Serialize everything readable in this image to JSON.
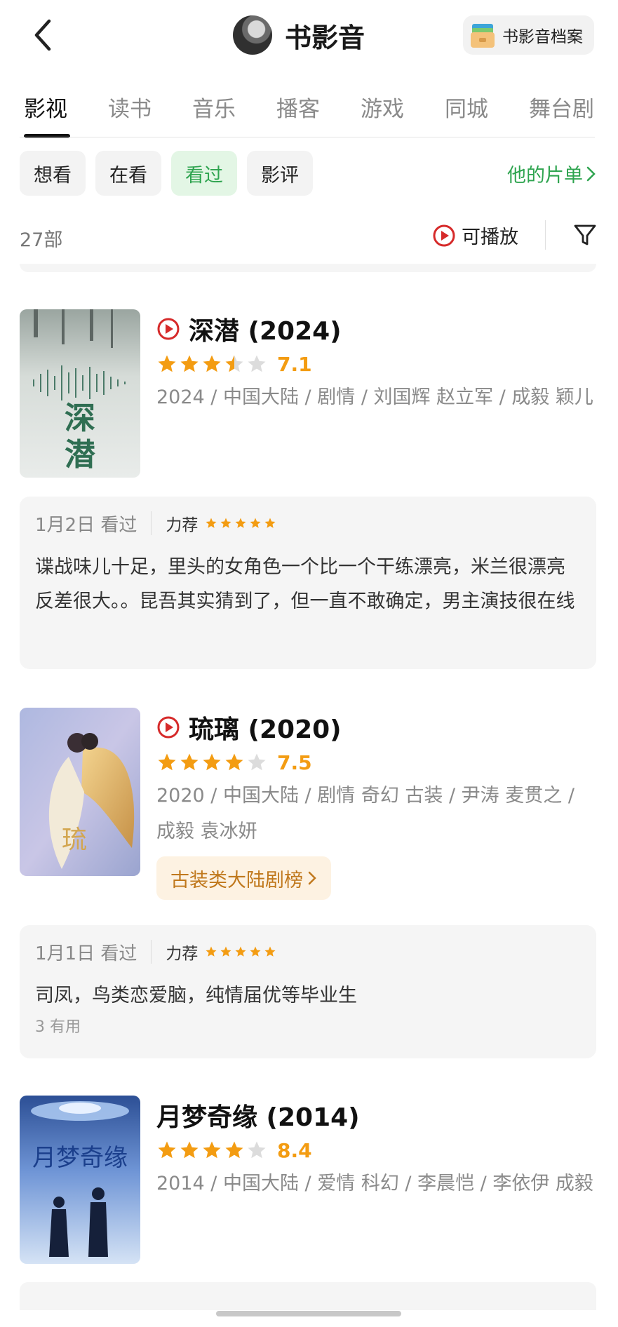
{
  "header": {
    "title": "书影音",
    "archive_label": "书影音档案"
  },
  "tabs": [
    "影视",
    "读书",
    "音乐",
    "播客",
    "游戏",
    "同城",
    "舞台剧"
  ],
  "chips": [
    "想看",
    "在看",
    "看过",
    "影评"
  ],
  "his_list_label": "他的片单",
  "count_label": "27部",
  "playable_label": "可播放",
  "items": [
    {
      "title": "深潜 (2024)",
      "rating": 7.1,
      "stars": 3.5,
      "score_label": "7.1",
      "meta": "2024 / 中国大陆 / 剧情 / 刘国辉 赵立军 / 成毅 颖儿",
      "poster_text": "深潜",
      "review": {
        "date": "1月2日 看过",
        "rec": "力荐",
        "stars": 5,
        "text": "谍战味儿十足，里头的女角色一个比一个干练漂亮，米兰很漂亮反差很大。。昆吾其实猜到了，但一直不敢确定，男主演技很在线"
      }
    },
    {
      "title": "琉璃 (2020)",
      "rating": 7.5,
      "stars": 4,
      "score_label": "7.5",
      "meta": "2020 / 中国大陆 / 剧情 奇幻 古装 / 尹涛 麦贯之 / 成毅 袁冰妍",
      "poster_text": "琉璃",
      "rank_tag": "古装类大陆剧榜",
      "review": {
        "date": "1月1日 看过",
        "rec": "力荐",
        "stars": 5,
        "text": "司凤，鸟类恋爱脑，纯情届优等毕业生",
        "useful": "3 有用"
      }
    },
    {
      "title": "月梦奇缘 (2014)",
      "rating": 8.4,
      "stars": 4,
      "score_label": "8.4",
      "meta": "2014 / 中国大陆 / 爱情 科幻 / 李晨恺 / 李依伊 成毅",
      "poster_text": "月梦奇缘"
    }
  ],
  "colors": {
    "accent_green": "#2ea44f",
    "star": "#f39c12",
    "play_red": "#d62a2a",
    "rank_orange": "#c0781c"
  }
}
